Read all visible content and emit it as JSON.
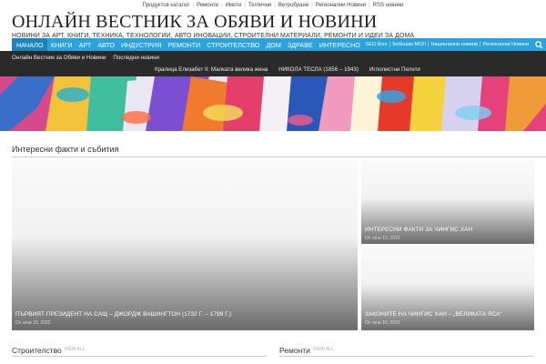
{
  "topbar": {
    "items": [
      "Продуктов каталог",
      "Ремонти",
      "Имоти",
      "Теглични",
      "Ветробрани",
      "Регионални Новини",
      "RSS новини"
    ]
  },
  "header": {
    "site_title": "ОНЛАЙН ВЕСТНИК ЗА ОБЯВИ И НОВИНИ",
    "tagline": "НОВИНИ ЗА АРТ, КНИГИ, ТЕХНИКА, ТЕХНОЛОГИИ, АВТО ИНОВАЦИИ, СТРОИТЕЛНИ МАТЕРИАЛИ, РЕМОНТИ И ИДЕИ ЗА ДОМА"
  },
  "nav": {
    "items": [
      "НАЧАЛО",
      "КНИГИ",
      "АРТ",
      "АВТО",
      "ИНДУСТРИЯ",
      "РЕМОНТИ",
      "СТРОИТЕЛСТВО",
      "ДОМ",
      "ЗДРАВЕ",
      "ИНТЕРЕСНО"
    ],
    "small_items": [
      "SEO блог",
      "Бебешки МОЛ",
      "Национални новини",
      "Регионални Новини"
    ]
  },
  "subnav": {
    "row1": [
      "Онлайн Вестник за Обяви и Новини",
      "Последни новини"
    ],
    "row2": [
      "Кралица Елизабет II: Малката велика жена",
      "НИКОЛА ТЕСЛА (1856 – 1943)",
      "Иглолистни Пелети"
    ]
  },
  "section": {
    "title": "Интересни факти и събития"
  },
  "cards": [
    {
      "title": "ПЪРВИЯТ ПРЕЗИДЕНТ НА САЩ – ДЖОРДЖ ВАШИНГТОН (1732 Г. – 1799 Г.)",
      "date": "От. юни 16, 2022"
    },
    {
      "title": "ИНТЕРЕСНИ ФАКТИ ЗА ЧИНГИС ХАН",
      "date": "От. юни 10, 2022"
    },
    {
      "title": "ЗАКОНИТЕ НА ЧИНГИС ХАН – „ВЕЛИКАТА ЯСА“",
      "date": "От. юни 10, 2022"
    }
  ],
  "lower_sections": [
    {
      "title": "Строителство",
      "view_all": "VIEW ALL"
    },
    {
      "title": "Ремонти",
      "view_all": "VIEW ALL"
    }
  ],
  "colors": {
    "nav_bg": "#29a3dd",
    "nav_active": "#1a85bd",
    "subnav_bg": "#2a2a2a"
  }
}
